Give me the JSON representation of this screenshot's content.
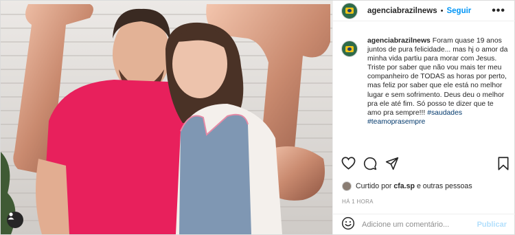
{
  "post": {
    "username": "agenciabrazilnews",
    "separator": "•",
    "follow_label": "Seguir",
    "more_label": "•••",
    "caption": {
      "username": "agenciabrazilnews",
      "text": "Foram quase 19 anos juntos de pura felicidade... mas hj o amor da minha vida partiu para morar com Jesus. Triste por saber que não vou mais ter meu companheiro de TODAS as horas por perto, mas feliz por saber que ele está no melhor lugar e sem sofrimento. Deus deu o melhor pra ele até fim. Só posso te dizer que te amo pra sempre!!!",
      "hashtags": [
        "#saudades",
        "#teamoprasempre"
      ]
    },
    "liked_by": {
      "prefix": "Curtido por",
      "user": "cfa.sp",
      "suffix": "e outras pessoas"
    },
    "timestamp": "HÁ 1 HORA",
    "comment": {
      "placeholder": "Adicione um comentário...",
      "publish_label": "Publicar"
    }
  },
  "icons": {
    "like": "heart-icon",
    "comment": "comment-icon",
    "share": "send-icon",
    "save": "bookmark-icon",
    "emoji": "emoji-icon",
    "tagged": "user-tag-icon"
  },
  "colors": {
    "follow": "#0095f6",
    "publish_disabled": "#b2dffc",
    "meta_gray": "#8e8e8e",
    "hashtag": "#00376b"
  }
}
